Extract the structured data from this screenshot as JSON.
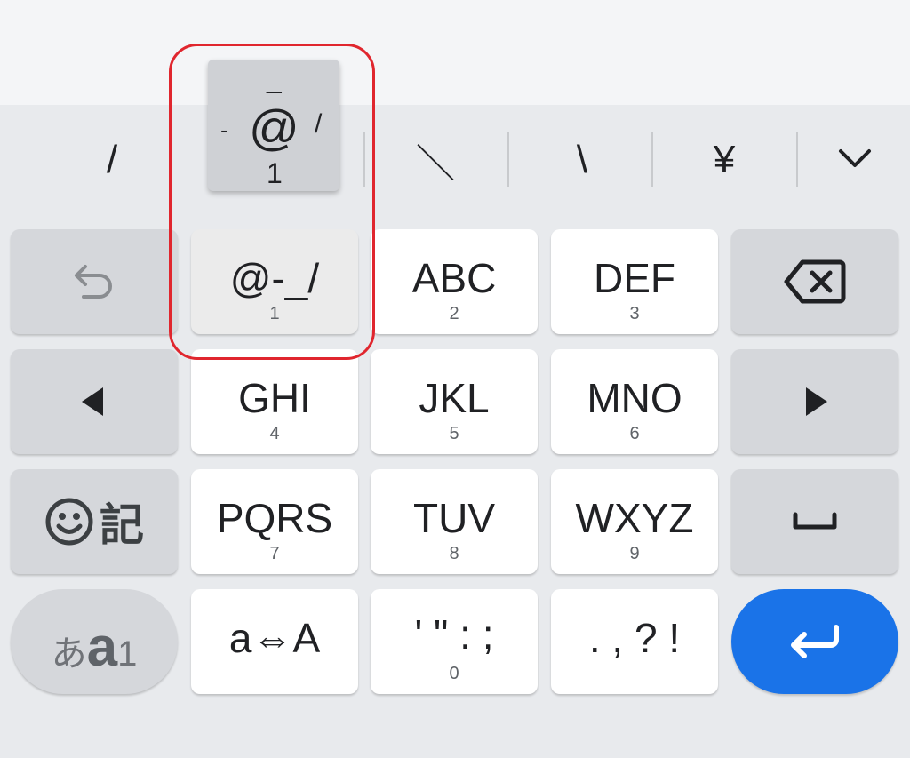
{
  "candidates": {
    "items": [
      "/",
      "＼",
      "\\",
      "¥"
    ],
    "expand_icon": "chevron-down-icon"
  },
  "flick_popup": {
    "center": "@",
    "up": "_",
    "left": "-",
    "right": "/",
    "down": "1"
  },
  "keys": {
    "row1": {
      "undo_icon": "undo-icon",
      "symbols": {
        "main": "@-_/",
        "sub": "1"
      },
      "abc": {
        "main": "ABC",
        "sub": "2"
      },
      "def": {
        "main": "DEF",
        "sub": "3"
      },
      "backspace_icon": "backspace-icon"
    },
    "row2": {
      "left_icon": "arrow-left-icon",
      "ghi": {
        "main": "GHI",
        "sub": "4"
      },
      "jkl": {
        "main": "JKL",
        "sub": "5"
      },
      "mno": {
        "main": "MNO",
        "sub": "6"
      },
      "right_icon": "arrow-right-icon"
    },
    "row3": {
      "emoji_symbol": {
        "icon": "smiley-icon",
        "label": "記"
      },
      "pqrs": {
        "main": "PQRS",
        "sub": "7"
      },
      "tuv": {
        "main": "TUV",
        "sub": "8"
      },
      "wxyz": {
        "main": "WXYZ",
        "sub": "9"
      },
      "space_icon": "space-icon"
    },
    "row4": {
      "mode": {
        "hira": "あ",
        "alpha": "a",
        "num": "1"
      },
      "case": {
        "main": "a⇔A"
      },
      "punct": {
        "main": "' \" : ;",
        "sub": "0"
      },
      "punct2": {
        "main": ". , ? !"
      },
      "enter_icon": "enter-icon"
    }
  },
  "colors": {
    "enter": "#1a73e8",
    "highlight": "#e0262e"
  }
}
